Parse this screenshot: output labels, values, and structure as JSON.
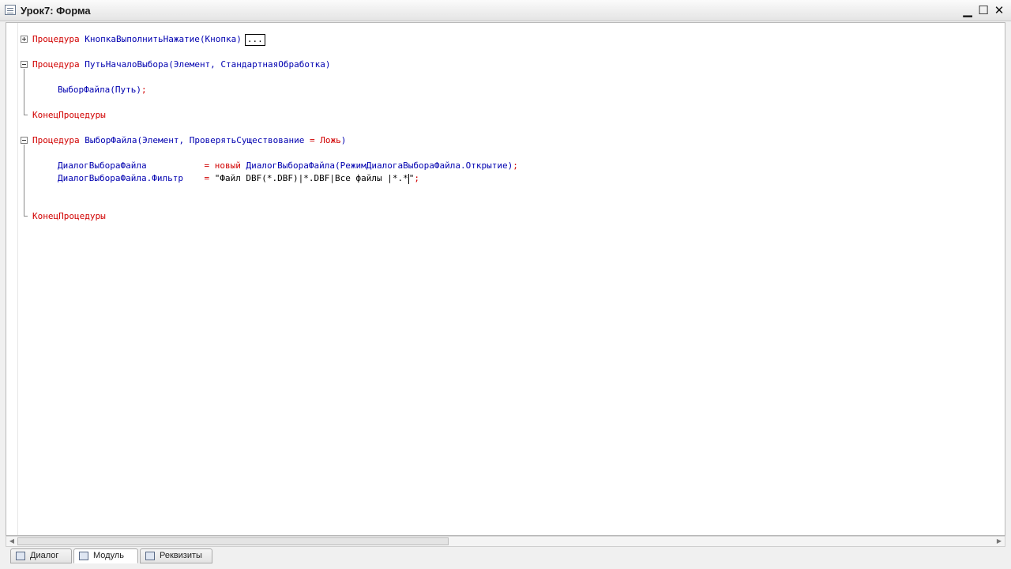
{
  "window": {
    "title": "Урок7: Форма",
    "minimize": "▁",
    "maximize": "☐",
    "close": "✕"
  },
  "code": {
    "l1": {
      "kw": "Процедура",
      "name": "КнопкаВыполнитьНажатие",
      "args": "(Кнопка)",
      "collapsed": "..."
    },
    "l2": {
      "kw": "Процедура",
      "name": "ПутьНачалоВыбора",
      "args": "(Элемент, СтандартнаяОбработка)"
    },
    "l3": {
      "call": "ВыборФайла",
      "args": "(Путь)",
      "end": ";"
    },
    "l4": {
      "kw": "КонецПроцедуры"
    },
    "l5": {
      "kw": "Процедура",
      "name": "ВыборФайла",
      "args_a": "(Элемент, ПроверятьСуществование ",
      "eq": "=",
      "val": " Ложь",
      "args_b": ")"
    },
    "l6": {
      "var": "ДиалогВыбораФайла",
      "pad": "           ",
      "eq": "=",
      "new": " новый",
      "rhs": " ДиалогВыбораФайла(РежимДиалогаВыбораФайла.Открытие)",
      "end": ";"
    },
    "l7": {
      "var": "ДиалогВыбораФайла.Фильтр",
      "pad": "    ",
      "eq": "=",
      "str": " \"Файл DBF(*.DBF)|*.DBF|Все файлы |*.*",
      "str_end": "\"",
      "end": ";"
    },
    "l8": {
      "kw": "КонецПроцедуры"
    }
  },
  "tabs": [
    {
      "label": "Диалог",
      "icon": "dialog-icon"
    },
    {
      "label": "Модуль",
      "icon": "module-icon"
    },
    {
      "label": "Реквизиты",
      "icon": "attributes-icon"
    }
  ],
  "scroll": {
    "left": "◀",
    "right": "▶"
  },
  "colors": {
    "keyword": "#d10000",
    "identifier": "#0000b0"
  }
}
